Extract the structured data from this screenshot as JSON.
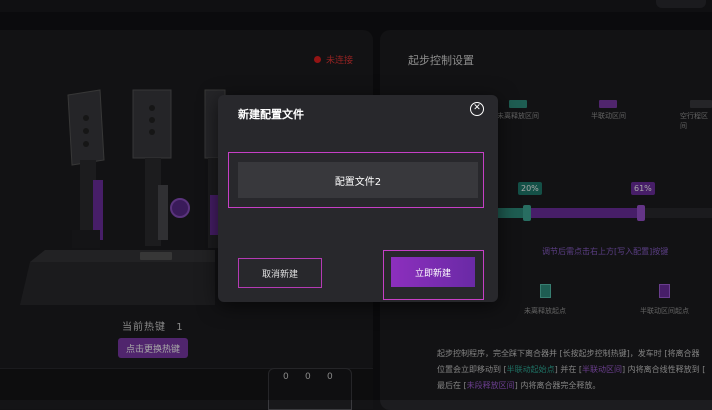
{
  "left_panel": {
    "connection_status": "未连接",
    "hotkey_label": "当前热键",
    "hotkey_value": "1",
    "change_hotkey_button": "点击更换热键",
    "counter_values": [
      "0",
      "0",
      "0"
    ]
  },
  "right_panel": {
    "title": "起步控制设置",
    "legend": [
      {
        "label": "未离释放区间",
        "color": "#2e8f7e"
      },
      {
        "label": "半联动区间",
        "color": "#7b3aa8"
      },
      {
        "label": "空行程区间",
        "color": "#3a3a3e"
      }
    ],
    "start_pct": "20%",
    "end_pct": "61%",
    "hint": "调节后需点击右上方[写入配置]按键",
    "points": [
      {
        "label": "未离释放起点"
      },
      {
        "label": "半联动区间起点"
      }
    ],
    "description": {
      "line1": "起步控制程序，完全踩下离合器并 [长按起步控制热键]，发车时 [将离合器",
      "line2a": "位置会立即移动到 [",
      "line2b": "半联动起始点",
      "line2c": "] 并在 [",
      "line2d": "半联动区间",
      "line2e": "] 内将离合线性释放到 [",
      "line3a": "最后在 [",
      "line3b": "未段释放区间",
      "line3c": "] 内将离合器完全释放。"
    },
    "colors": {
      "green": "#2fae9a",
      "purple": "#a25ed9"
    }
  },
  "modal": {
    "title": "新建配置文件",
    "input_value": "配置文件2",
    "cancel_button": "取消新建",
    "confirm_button": "立即新建"
  }
}
